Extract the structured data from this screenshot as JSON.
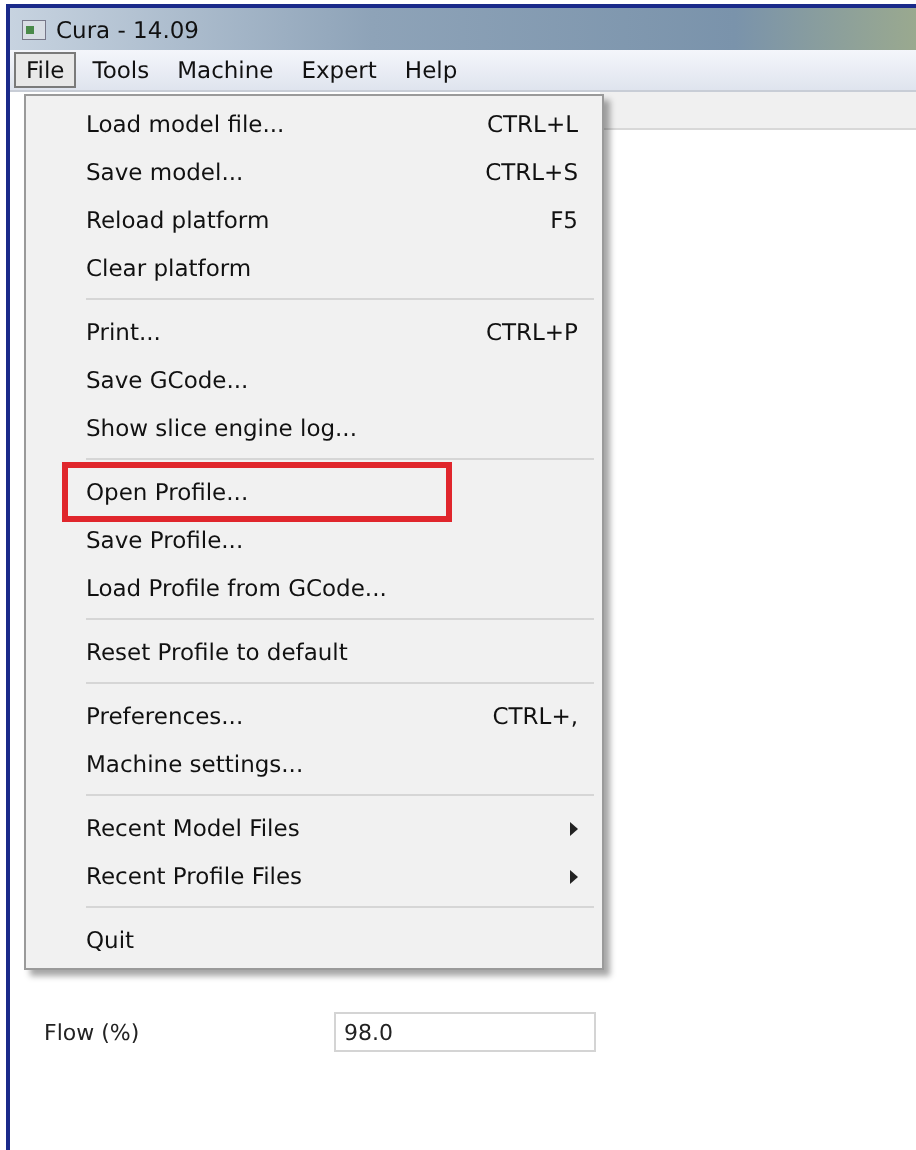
{
  "window": {
    "title": "Cura - 14.09"
  },
  "menu_bar": [
    {
      "label": "File",
      "selected": true
    },
    {
      "label": "Tools",
      "selected": false
    },
    {
      "label": "Machine",
      "selected": false
    },
    {
      "label": "Expert",
      "selected": false
    },
    {
      "label": "Help",
      "selected": false
    }
  ],
  "file_menu": [
    [
      {
        "label": "Load model file...",
        "shortcut": "CTRL+L",
        "submenu": false,
        "outlined": false
      },
      {
        "label": "Save model...",
        "shortcut": "CTRL+S",
        "submenu": false,
        "outlined": false
      },
      {
        "label": "Reload platform",
        "shortcut": "F5",
        "submenu": false,
        "outlined": false
      },
      {
        "label": "Clear platform",
        "submenu": false,
        "outlined": false
      }
    ],
    [
      {
        "label": "Print...",
        "shortcut": "CTRL+P",
        "submenu": false,
        "outlined": false
      },
      {
        "label": "Save GCode...",
        "submenu": false,
        "outlined": false
      },
      {
        "label": "Show slice engine log...",
        "submenu": false,
        "outlined": false
      }
    ],
    [
      {
        "label": "Open Profile...",
        "submenu": false,
        "outlined": true
      },
      {
        "label": "Save Profile...",
        "submenu": false,
        "outlined": false
      },
      {
        "label": "Load Profile from GCode...",
        "submenu": false,
        "outlined": false
      }
    ],
    [
      {
        "label": "Reset Profile to default",
        "submenu": false,
        "outlined": false
      }
    ],
    [
      {
        "label": "Preferences...",
        "shortcut": "CTRL+,",
        "submenu": false,
        "outlined": false
      },
      {
        "label": "Machine settings...",
        "submenu": false,
        "outlined": false
      }
    ],
    [
      {
        "label": "Recent Model Files",
        "submenu": true,
        "outlined": false
      },
      {
        "label": "Recent Profile Files",
        "submenu": true,
        "outlined": false
      }
    ],
    [
      {
        "label": "Quit",
        "submenu": false,
        "outlined": false
      }
    ]
  ],
  "settings": [
    {
      "label": "Flow (%)",
      "value": "98.0"
    }
  ]
}
